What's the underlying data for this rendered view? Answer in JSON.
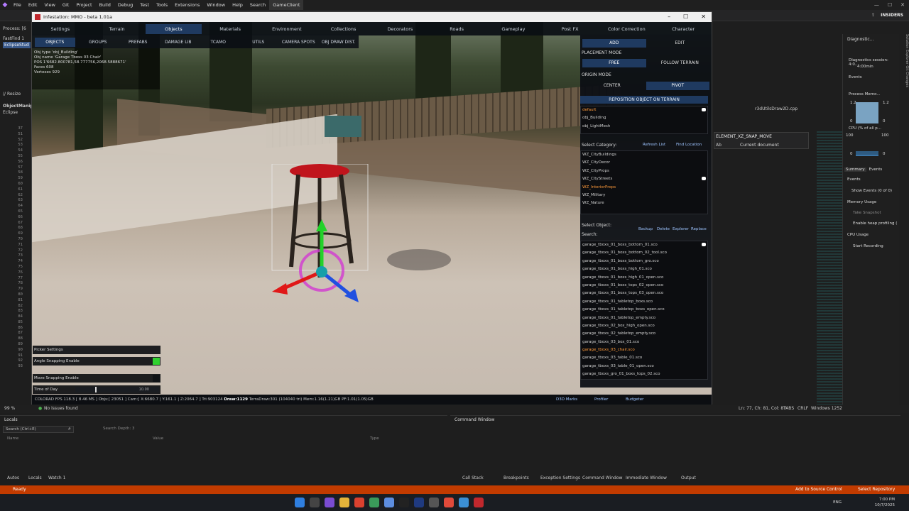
{
  "vs": {
    "menus": [
      "File",
      "Edit",
      "View",
      "Git",
      "Project",
      "Build",
      "Debug",
      "Test",
      "Tools",
      "Extensions",
      "Window",
      "Help",
      "Search"
    ],
    "active_project": "GameClient",
    "insiders": "INSIDERS",
    "left_rows": [
      "Process: [6",
      "FastFind 1",
      "EclipseStud",
      "// Resize",
      "ObjectManip",
      "Eclipse"
    ],
    "line_numbers": [
      "37",
      "51",
      "52",
      "53",
      "54",
      "55",
      "56",
      "57",
      "58",
      "59",
      "60",
      "61",
      "62",
      "63",
      "64",
      "65",
      "66",
      "67",
      "68",
      "69",
      "70",
      "71",
      "72",
      "73",
      "74",
      "75",
      "76",
      "77",
      "78",
      "79",
      "80",
      "81",
      "82",
      "83",
      "84",
      "85",
      "86",
      "87",
      "88",
      "89",
      "90",
      "91",
      "92",
      "93"
    ],
    "code_file_tab": "r3dUtilsDraw2D.cpp",
    "find_term": "ELEMENT_XZ_SNAP_MOVE",
    "find_scope": "Current document",
    "find_ab": "Ab",
    "zoom": "99 %",
    "issues": "No issues found",
    "cursor_pos": "Ln: 77, Ch: 81, Col: 87",
    "tabs": "TABS",
    "eol": "CRLF",
    "encoding": "Windows 1252",
    "locals_title": "Locals",
    "locals_search": "Search (Ctrl+E)",
    "search_depth": "Search Depth:",
    "search_depth_value": "3",
    "col_name": "Name",
    "col_value": "Value",
    "col_type": "Type",
    "command_window": "Command Window",
    "bottom_tabs_left": [
      "Autos",
      "Locals",
      "Watch 1"
    ],
    "bottom_tabs_right": [
      "Call Stack",
      "Breakpoints",
      "Exception Settings",
      "Command Window",
      "Immediate Window",
      "Output"
    ],
    "ready": "Ready",
    "add_source": "Add to Source Control",
    "select_repo": "Select Repository",
    "diag": {
      "title": "Diagnostic...",
      "session": "Diagnostics session: 4:0...",
      "session_time": "4:00min",
      "events": "Events",
      "process_mem": "Process Memo...",
      "pm_max": "1.2",
      "pm_min": "0",
      "cpu": "CPU (% of all p...",
      "cpu_max": "100",
      "cpu_min": "0",
      "tab_summary": "Summary",
      "tab_events": "Events",
      "events_label": "Events",
      "show_events": "Show Events (0 of 0)",
      "memory_usage": "Memory Usage",
      "take_snapshot": "Take Snapshot",
      "heap_profiling": "Enable heap profiling (",
      "cpu_usage": "CPU Usage",
      "start_recording": "Start Recording"
    },
    "right_sidebar": "Solution Explorer   Git Changes",
    "tray": {
      "lang": "ENG",
      "time": "7:00 PM",
      "date": "10/7/2025"
    }
  },
  "game": {
    "title": "Infestation: MMO - beta 1.01a",
    "tabs1": [
      "Settings",
      "Terrain",
      "Objects",
      "Materials",
      "Environment",
      "Collections",
      "Decorators",
      "Roads",
      "Gameplay",
      "Post FX",
      "Color Correction",
      "Character"
    ],
    "active_tab1": 2,
    "tabs2": [
      "OBJECTS",
      "GROUPS",
      "PREFABS",
      "DAMAGE LIB",
      "TCAMO",
      "UTILS",
      "CAMERA SPOTS",
      "OBJ DRAW DIST."
    ],
    "active_tab2": 0,
    "info": [
      "Obj type 'obj_Building'",
      "Obj name 'Garage Tboxs 03 Chair'",
      "POS 1'6682.800781,58.777756,2068.5888671'",
      "Faces 608",
      "Vertexes 929"
    ],
    "panel": {
      "add": "ADD",
      "edit": "EDIT",
      "placement_mode": "PLACEMENT MODE",
      "free": "FREE",
      "follow_terrain": "FOLLOW TERRAIN",
      "origin_mode": "ORIGIN MODE",
      "center": "CENTER",
      "pivot": "PIVOT",
      "reposition": "REPOSITION OBJECT ON TERRAIN",
      "types": [
        "default",
        "obj_Building",
        "obj_LightMesh"
      ],
      "select_category": "Select Category:",
      "refresh_list": "Refresh List",
      "find_location": "Find Location",
      "categories": [
        "WZ_CityBuildings",
        "WZ_CityDecor",
        "WZ_CityProps",
        "WZ_CityStreets",
        "WZ_InteriorProps",
        "WZ_Military",
        "WZ_Nature"
      ],
      "selected_category": 4,
      "select_object": "Select Object:",
      "search": "Search:",
      "backup": "Backup",
      "delete": "Delete",
      "explorer": "Explorer",
      "replace": "Replace",
      "objects": [
        "garage_tboxs_01_boxs_bottom_01.sco",
        "garage_tboxs_01_boxs_bottom_02_tool.sco",
        "garage_tboxs_01_boxs_bottom_gro.sco",
        "garage_tboxs_01_boxs_high_01.sco",
        "garage_tboxs_01_boxs_high_01_open.sco",
        "garage_tboxs_01_boxs_tops_02_open.sco",
        "garage_tboxs_01_boxs_tops_03_open.sco",
        "garage_tboxs_01_tabletop_boxs.sco",
        "garage_tboxs_01_tabletop_boxs_open.sco",
        "garage_tboxs_01_tabletop_empty.sco",
        "garage_tboxs_02_box_high_open.sco",
        "garage_tboxs_02_tabletop_empty.sco",
        "garage_tboxs_03_box_01.sco",
        "garage_tboxs_03_chair.sco",
        "garage_tboxs_03_table_01.sco",
        "garage_tboxs_03_table_01_open.sco",
        "garage_tboxs_gro_01_boxs_tops_02.sco"
      ],
      "selected_object": 13
    },
    "controls": {
      "picker_settings": "Picker Settings",
      "angle_snapping": "Angle Snapping Enable",
      "move_snapping": "Move Snapping Enable",
      "time_of_day": "Time of Day",
      "time_value": "10.00"
    },
    "status": {
      "fps": "COLORAD FPS 118.3 [ 8.46 MS ] Objs:[ 23051 ] Cam:[ X:6680.7 | Y:161.1 | Z:2064.7 ] Tri:903124",
      "draw": "Draw:1129",
      "rest": "TerraDraw:301 (104040 tri) Mem:1.16(1.21)GB PF:1.01(1.05)GB",
      "d3d_marks": "D3D Marks",
      "profiler": "Profiler",
      "budgeter": "Budgeter"
    }
  },
  "colors": {
    "accent": "#1f3a60",
    "highlight": "#ff9a3a",
    "status_bar": "#c23b00",
    "checkbox_on": "#2fd12f"
  }
}
